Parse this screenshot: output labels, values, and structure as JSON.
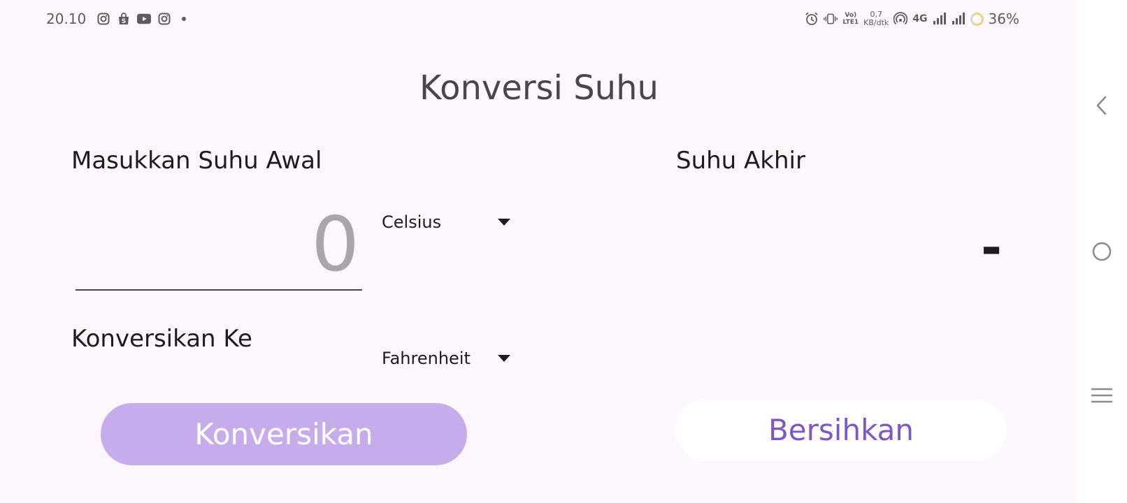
{
  "status_bar": {
    "time": "20.10",
    "left_icons": [
      "instagram-icon",
      "shop-bag-icon",
      "youtube-icon",
      "instagram-icon",
      "dot-icon"
    ],
    "volte_top": "Vo)",
    "volte_bottom": "LTE1",
    "speed_value": "0,7",
    "speed_unit": "KB/dtk",
    "network_type": "4G",
    "battery_percent": "36%"
  },
  "page": {
    "title": "Konversi Suhu"
  },
  "input_section": {
    "label": "Masukkan Suhu Awal",
    "placeholder": "0",
    "from_unit": "Celsius"
  },
  "convert_to": {
    "label": "Konversikan Ke",
    "to_unit": "Fahrenheit"
  },
  "result_section": {
    "label": "Suhu Akhir",
    "value": "-"
  },
  "buttons": {
    "convert_label": "Konversikan",
    "clear_label": "Bersihkan"
  },
  "colors": {
    "background": "#fdf6fd",
    "convert_button": "#c7acec",
    "clear_text": "#7e57c2"
  }
}
